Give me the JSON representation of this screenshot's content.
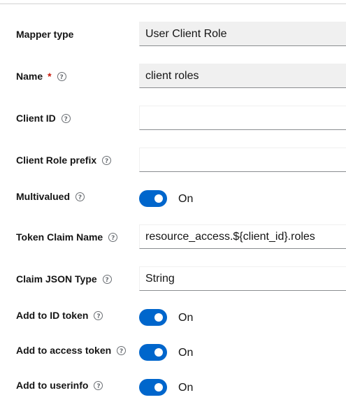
{
  "form": {
    "mapper_type": {
      "label": "Mapper type",
      "value": "User Client Role"
    },
    "name": {
      "label": "Name",
      "required_mark": "*",
      "value": "client roles"
    },
    "client_id": {
      "label": "Client ID",
      "value": ""
    },
    "client_role_prefix": {
      "label": "Client Role prefix",
      "value": ""
    },
    "multivalued": {
      "label": "Multivalued",
      "state": "On"
    },
    "token_claim_name": {
      "label": "Token Claim Name",
      "value": "resource_access.${client_id}.roles"
    },
    "claim_json_type": {
      "label": "Claim JSON Type",
      "value": "String"
    },
    "add_to_id_token": {
      "label": "Add to ID token",
      "state": "On"
    },
    "add_to_access_token": {
      "label": "Add to access token",
      "state": "On"
    },
    "add_to_userinfo": {
      "label": "Add to userinfo",
      "state": "On"
    }
  },
  "icons": {
    "help": "help-circle-icon"
  },
  "colors": {
    "toggle_on": "#0066cc",
    "required": "#c9190b",
    "readonly_bg": "#f0f0f0"
  }
}
